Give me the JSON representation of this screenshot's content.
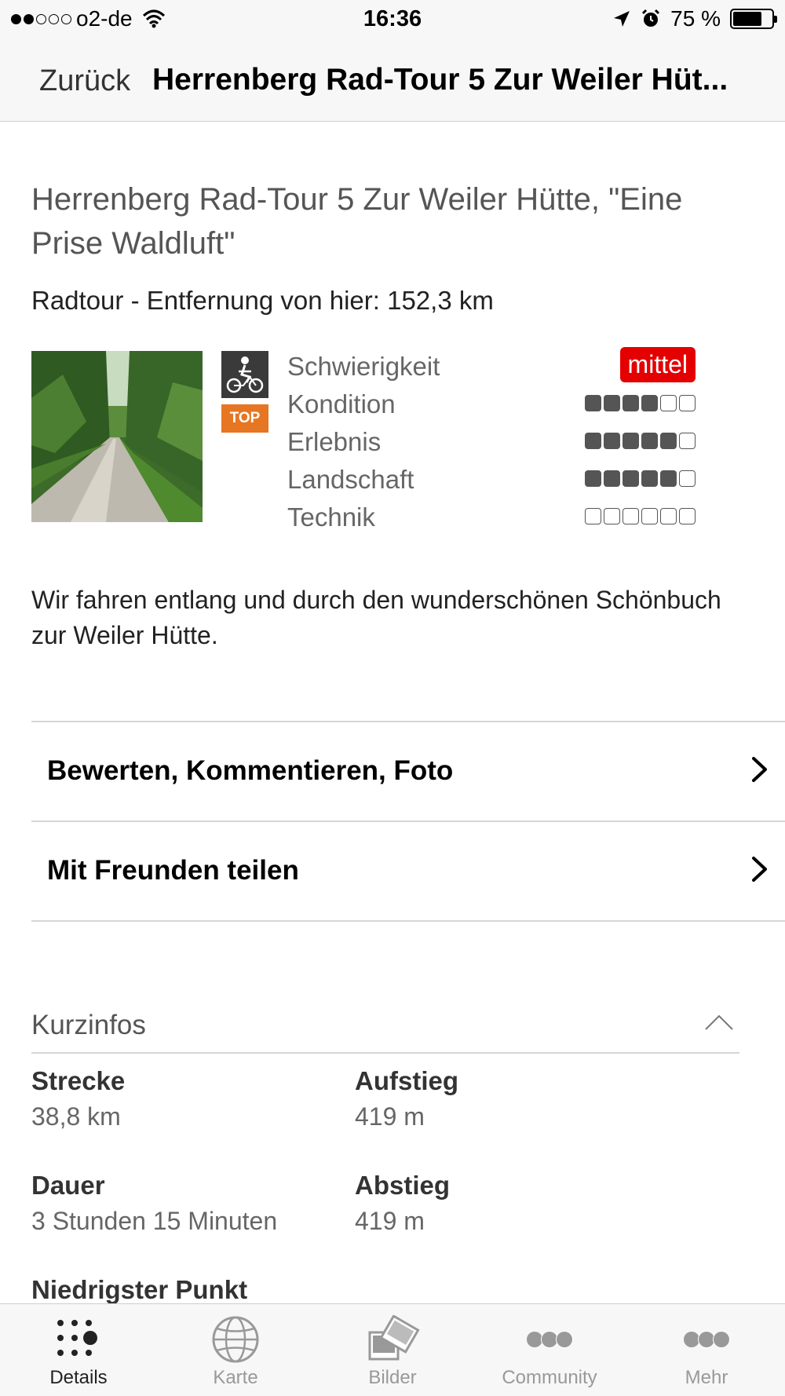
{
  "status_bar": {
    "carrier": "o2-de",
    "time": "16:36",
    "battery": "75 %",
    "battery_level": 0.75
  },
  "nav": {
    "back_label": "Zurück",
    "title": "Herrenberg Rad-Tour 5 Zur Weiler Hüt..."
  },
  "tour": {
    "title": "Herrenberg Rad-Tour 5 Zur Weiler Hütte, \"Eine Prise Waldluft\"",
    "subtitle": "Radtour - Entfernung von hier: 152,3 km",
    "badge": "TOP",
    "difficulty_label": "Schwierigkeit",
    "difficulty_value": "mittel",
    "ratings": [
      {
        "label": "Kondition",
        "score": 4,
        "max": 6
      },
      {
        "label": "Erlebnis",
        "score": 5,
        "max": 6
      },
      {
        "label": "Landschaft",
        "score": 5,
        "max": 6
      },
      {
        "label": "Technik",
        "score": 0,
        "max": 6
      }
    ],
    "description": "Wir fahren entlang und durch den wunderschönen Schönbuch zur Weiler Hütte."
  },
  "actions": [
    {
      "label": "Bewerten, Kommentieren, Foto"
    },
    {
      "label": "Mit Freunden teilen"
    }
  ],
  "kurzinfos": {
    "title": "Kurzinfos",
    "items": [
      {
        "label": "Strecke",
        "value": "38,8 km"
      },
      {
        "label": "Aufstieg",
        "value": "419 m"
      },
      {
        "label": "Dauer",
        "value": "3 Stunden 15 Minuten"
      },
      {
        "label": "Abstieg",
        "value": "419 m"
      },
      {
        "label": "Niedrigster Punkt",
        "value": ""
      }
    ]
  },
  "tabs": [
    {
      "label": "Details",
      "icon": "details-grid-icon",
      "active": true
    },
    {
      "label": "Karte",
      "icon": "globe-icon",
      "active": false
    },
    {
      "label": "Bilder",
      "icon": "pictures-icon",
      "active": false
    },
    {
      "label": "Community",
      "icon": "community-icon",
      "active": false
    },
    {
      "label": "Mehr",
      "icon": "more-icon",
      "active": false
    }
  ],
  "colors": {
    "difficulty_red": "#e40000",
    "top_orange": "#e67622"
  }
}
